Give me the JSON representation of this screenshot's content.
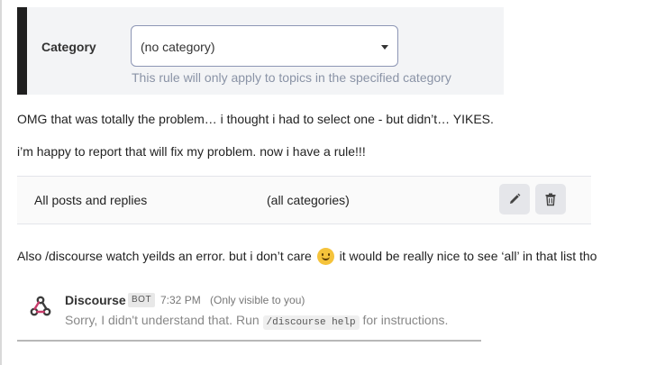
{
  "category_panel": {
    "label": "Category",
    "select_value": "(no category)",
    "help_text": "This rule will only apply to topics in the specified category"
  },
  "messages": {
    "line1": "OMG that was totally the problem… i thought i had to select one - but didn’t… YIKES.",
    "line2": "i’m happy to report that will fix my problem. now i have a rule!!!",
    "line3_before": "Also /discourse watch yeilds an error. but i don’t care",
    "line3_after": "it would be really nice to see ‘all’ in that list tho"
  },
  "rule_table": {
    "filter": "All posts and replies",
    "category": "(all categories)"
  },
  "bot_message": {
    "name": "Discourse",
    "badge": "BOT",
    "time": "7:32 PM",
    "visibility": "(Only visible to you)",
    "text_before": "Sorry, I didn't understand that. Run",
    "command": "/discourse help",
    "text_after": "for instructions."
  },
  "icons": {
    "edit": "pencil-icon",
    "delete": "trash-icon",
    "emoji": "slightly-smiling-face-icon",
    "avatar": "webhook-logo-icon"
  }
}
